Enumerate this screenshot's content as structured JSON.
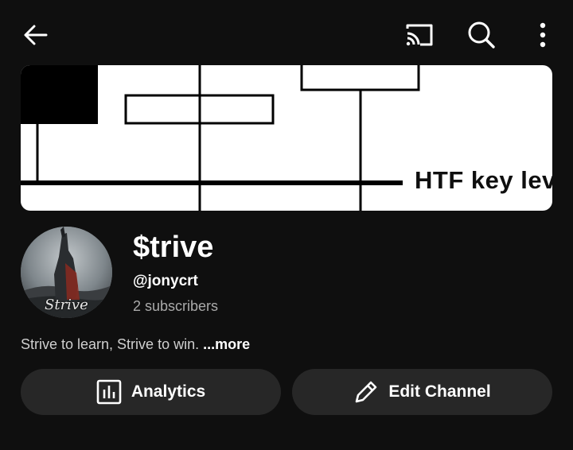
{
  "header": {
    "back_icon": "arrow-left-icon",
    "cast_icon": "cast-icon",
    "search_icon": "search-icon",
    "more_icon": "more-vertical-icon"
  },
  "banner": {
    "label": "HTF key lev"
  },
  "channel": {
    "name": "$trive",
    "handle": "@jonycrt",
    "subscribers": "2 subscribers",
    "avatar_text": "Strive",
    "description": "Strive to learn, Strive to win. ",
    "more_label": "...more"
  },
  "actions": {
    "analytics_label": "Analytics",
    "analytics_icon": "bar-chart-icon",
    "edit_label": "Edit Channel",
    "edit_icon": "pencil-icon"
  },
  "colors": {
    "background": "#0f0f0f",
    "button_bg": "#272727",
    "secondary_text": "#aaaaaa"
  }
}
